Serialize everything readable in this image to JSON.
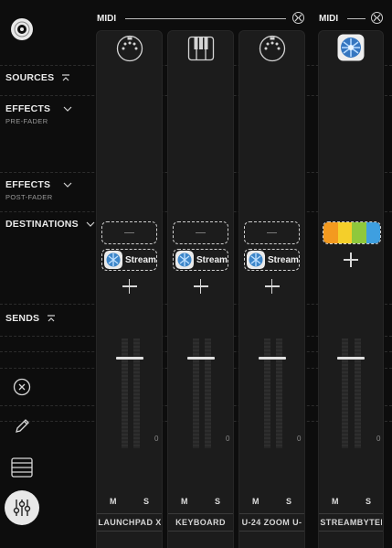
{
  "app": {
    "logo_icon": "disc-icon"
  },
  "groups": [
    {
      "id": "midi-a",
      "label": "MIDI"
    },
    {
      "id": "midi-b",
      "label": "MIDI"
    }
  ],
  "sections": {
    "sources": {
      "label": "SOURCES",
      "icon": "collapse-up-icon"
    },
    "effects_pre": {
      "label": "EFFECTS",
      "sublabel": "PRE-FADER",
      "icon": "chevron-down-icon"
    },
    "effects_post": {
      "label": "EFFECTS",
      "sublabel": "POST-FADER",
      "icon": "chevron-down-icon"
    },
    "destinations": {
      "label": "DESTINATIONS",
      "icon": "chevron-down-icon"
    },
    "sends": {
      "label": "SENDS",
      "icon": "collapse-up-icon"
    }
  },
  "strips": [
    {
      "name": "LAUNCHPAD X",
      "icon": "midi-din-icon",
      "destination": "Stream",
      "empty_slot": "–",
      "level_readout": "0",
      "mute": "M",
      "solo": "S",
      "level": 0.45
    },
    {
      "name": "KEYBOARD",
      "icon": "piano-keys-icon",
      "destination": "Stream",
      "empty_slot": "–",
      "level_readout": "0",
      "mute": "M",
      "solo": "S",
      "level": 0.45
    },
    {
      "name": "U-24 ZOOM U-",
      "icon": "midi-din-icon",
      "destination": "Stream",
      "empty_slot": "–",
      "level_readout": "0",
      "mute": "M",
      "solo": "S",
      "level": 0.45
    },
    {
      "name": "STREAMBYTER",
      "icon": "streambyter-icon",
      "level_readout": "0",
      "mute": "M",
      "solo": "S",
      "level": 0.45
    }
  ],
  "tools": [
    "close-circle-icon",
    "pencil-icon",
    "list-icon",
    "mixer-sliders-icon"
  ],
  "colors": {
    "active_tool": "#e8e8e8",
    "bar_orange": "#f39a1f",
    "bar_yellow": "#f4cf2a",
    "bar_green": "#8fc83c",
    "bar_blue": "#3e9fe0"
  }
}
